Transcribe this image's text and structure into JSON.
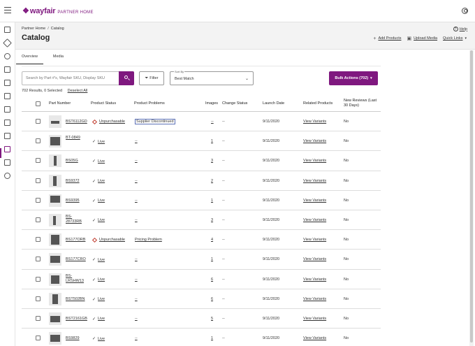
{
  "brand": {
    "logo": "wayfair",
    "sub": "PARTNER HOME",
    "color": "#7f187f"
  },
  "breadcrumb": [
    "Partner Home",
    "Catalog"
  ],
  "page_title": "Catalog",
  "help_label": "Help",
  "actions": {
    "add_products": "Add Products",
    "upload_media": "Upload Media",
    "quick_links": "Quick Links"
  },
  "tabs": [
    "Overview",
    "Media"
  ],
  "search": {
    "placeholder": "Search by Part #'s, Wayfair SKU, Display SKU"
  },
  "filter_label": "Filter",
  "sort": {
    "label": "Sort By",
    "value": "Best Match"
  },
  "bulk_label": "Bulk Actions (702)",
  "results": {
    "summary": "702 Results, 0 Selected",
    "deselect": "Deselect All"
  },
  "columns": {
    "part_number": "Part Number",
    "product_status": "Product Status",
    "product_problems": "Product Problems",
    "images": "Images",
    "change_status": "Change Status",
    "launch_date": "Launch Date",
    "related_products": "Related Products",
    "new_reviews": "New Reviews (Last 30 Days)"
  },
  "rows": [
    {
      "part": "BST6112GD",
      "status": "Unpurchasable",
      "status_type": "warn",
      "problems": "Supplier Discontinued",
      "boxed": true,
      "images": "--",
      "change": "--",
      "launch": "9/11/2020",
      "related": "View Variants",
      "reviews": "No"
    },
    {
      "part": "BT-0849",
      "status": "Live",
      "status_type": "live",
      "problems": "--",
      "boxed": false,
      "images": "1",
      "change": "--",
      "launch": "9/11/2020",
      "related": "View Variants",
      "reviews": "No"
    },
    {
      "part": "BS05G",
      "status": "Live",
      "status_type": "live",
      "problems": "--",
      "boxed": false,
      "images": "3",
      "change": "--",
      "launch": "9/11/2020",
      "related": "View Variants",
      "reviews": "No"
    },
    {
      "part": "BS9372",
      "status": "Live",
      "status_type": "live",
      "problems": "--",
      "boxed": false,
      "images": "2",
      "change": "--",
      "launch": "9/11/2020",
      "related": "View Variants",
      "reviews": "No"
    },
    {
      "part": "BS9395",
      "status": "Live",
      "status_type": "live",
      "problems": "--",
      "boxed": false,
      "images": "1",
      "change": "--",
      "launch": "9/11/2020",
      "related": "View Variants",
      "reviews": "No"
    },
    {
      "part": "BS-28733RB",
      "status": "Live",
      "status_type": "live",
      "problems": "--",
      "boxed": false,
      "images": "3",
      "change": "--",
      "launch": "9/11/2020",
      "related": "View Variants",
      "reviews": "No"
    },
    {
      "part": "BS177ORB",
      "status": "Unpurchasable",
      "status_type": "warn",
      "problems": "Pricing Problem",
      "boxed": false,
      "images": "4",
      "change": "--",
      "launch": "9/11/2020",
      "related": "View Variants",
      "reviews": "No"
    },
    {
      "part": "BS177CRO",
      "status": "Live",
      "status_type": "live",
      "problems": "--",
      "boxed": false,
      "images": "1",
      "change": "--",
      "launch": "9/11/2020",
      "related": "View Variants",
      "reviews": "No"
    },
    {
      "part": "BS-LRSHW13",
      "status": "Live",
      "status_type": "live",
      "problems": "--",
      "boxed": false,
      "images": "6",
      "change": "--",
      "launch": "9/11/2020",
      "related": "View Variants",
      "reviews": "No"
    },
    {
      "part": "BST502BN",
      "status": "Live",
      "status_type": "live",
      "problems": "--",
      "boxed": false,
      "images": "6",
      "change": "--",
      "launch": "9/11/2020",
      "related": "View Variants",
      "reviews": "No"
    },
    {
      "part": "BST2161GB",
      "status": "Live",
      "status_type": "live",
      "problems": "--",
      "boxed": false,
      "images": "5",
      "change": "--",
      "launch": "9/11/2020",
      "related": "View Variants",
      "reviews": "No"
    },
    {
      "part": "BS9829",
      "status": "Live",
      "status_type": "live",
      "problems": "--",
      "boxed": false,
      "images": "1",
      "change": "--",
      "launch": "9/11/2020",
      "related": "View Variants",
      "reviews": "No"
    }
  ]
}
